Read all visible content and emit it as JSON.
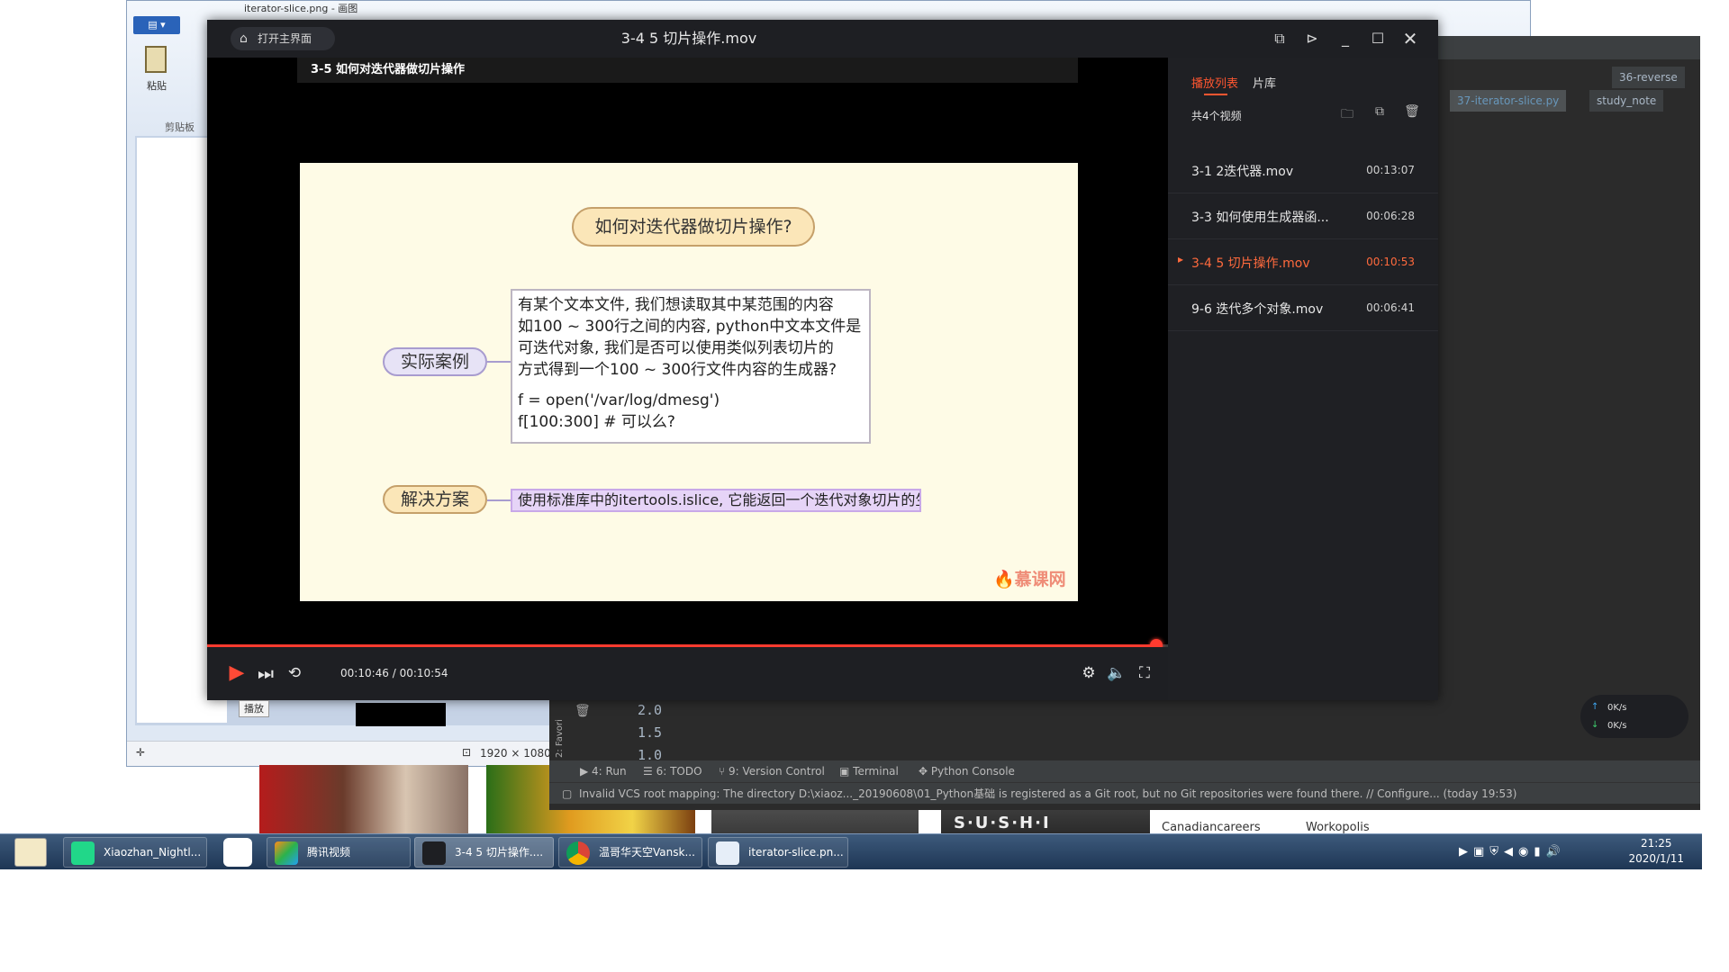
{
  "player": {
    "home_label": "打开主界面",
    "title": "3-4 5 切片操作.mov",
    "video_header": "3-5 如何对迭代器做切片操作",
    "current_time": "00:10:46",
    "total_time": "00:10:54",
    "progress": 0.988,
    "play_tooltip": "播放"
  },
  "slide": {
    "title": "如何对迭代器做切片操作?",
    "case_label": "实际案例",
    "case_text": [
      "有某个文本文件, 我们想读取其中某范围的内容",
      "如100 ~ 300行之间的内容, python中文本文件是",
      "可迭代对象, 我们是否可以使用类似列表切片的",
      "方式得到一个100 ~ 300行文件内容的生成器?"
    ],
    "code_1": "f = open('/var/log/dmesg')",
    "code_2": "f[100:300]   # 可以么?",
    "solution_label": "解决方案",
    "solution_text": "使用标准库中的itertools.islice, 它能返回一个迭代对象切片的生成器.",
    "watermark": "慕课网"
  },
  "playlist": {
    "tab_playlist": "播放列表",
    "tab_library": "片库",
    "count": "共4个视频",
    "items": [
      {
        "name": "3-1 2迭代器.mov",
        "duration": "00:13:07"
      },
      {
        "name": "3-3 如何使用生成器函...",
        "duration": "00:06:28"
      },
      {
        "name": "3-4 5 切片操作.mov",
        "duration": "00:10:53"
      },
      {
        "name": "9-6 迭代多个对象.mov",
        "duration": "00:06:41"
      }
    ]
  },
  "paint": {
    "window_title": "iterator-slice.png - 画图",
    "paste_label": "粘贴",
    "clipboard_label": "剪贴板",
    "size_label": "1920 × 1080"
  },
  "pycharm": {
    "tabs": [
      "36-reverse",
      "37-iterator-slice.py",
      "study_note"
    ],
    "console": [
      "2.0",
      "1.5",
      "1.0"
    ],
    "tools": [
      "4: Run",
      "6: TODO",
      "9: Version Control",
      "Terminal",
      "Python Console"
    ],
    "side_label": "2: Favori",
    "status": "Invalid VCS root mapping: The directory D:\\xiaoz..._20190608\\01_Python基础 is registered as a Git root, but no Git repositories were found there. // Configure... (today 19:53)"
  },
  "background": {
    "ad_1": "Canadiancareers",
    "ad_2": "Workopolis",
    "sushi": "S·U·S·H·I",
    "net_up": "0K/s",
    "net_down": "0K/s"
  },
  "taskbar": {
    "items": [
      "Xiaozhan_Nightl...",
      "腾讯视频",
      "3-4 5 切片操作....",
      "温哥华天空Vansk...",
      "iterator-slice.pn..."
    ],
    "time": "21:25",
    "date": "2020/1/11"
  }
}
